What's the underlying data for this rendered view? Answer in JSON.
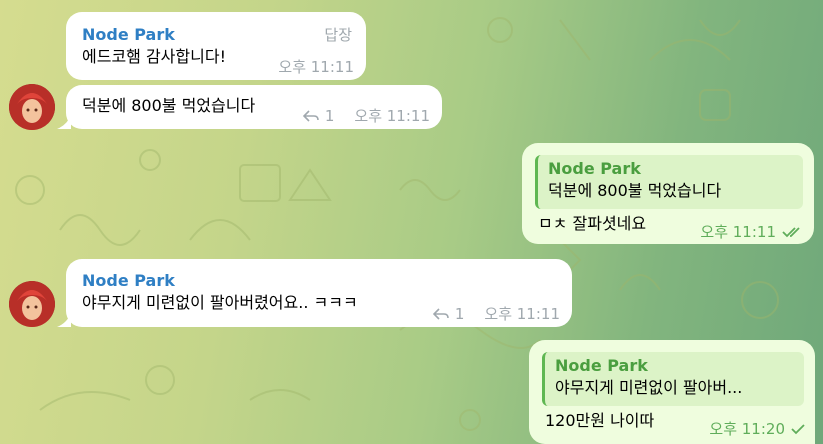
{
  "messages": [
    {
      "sender": "Node Park",
      "text": "에드코햄 감사합니다!",
      "time": "오후 11:11",
      "action": "답장"
    },
    {
      "text": "덕분에 800불 먹었습니다",
      "reply_count": "1",
      "time": "오후 11:11"
    },
    {
      "quote_sender": "Node Park",
      "quote_text": "덕분에 800불 먹었습니다",
      "text": "ㅁㅊ 잘파셧네요",
      "time": "오후 11:11",
      "status": "read"
    },
    {
      "sender": "Node Park",
      "text": "야무지게 미련없이 팔아버렸어요.. ㅋㅋㅋ",
      "reply_count": "1",
      "time": "오후 11:11"
    },
    {
      "quote_sender": "Node Park",
      "quote_text": "야무지게 미련없이 팔아버...",
      "text": "120만원 나이따",
      "time": "오후 11:20",
      "status": "sent"
    }
  ],
  "colors": {
    "incoming_bubble": "#ffffff",
    "outgoing_bubble": "#effdde",
    "sender_name": "#2f7fc4",
    "quote_accent": "#5fb752"
  }
}
